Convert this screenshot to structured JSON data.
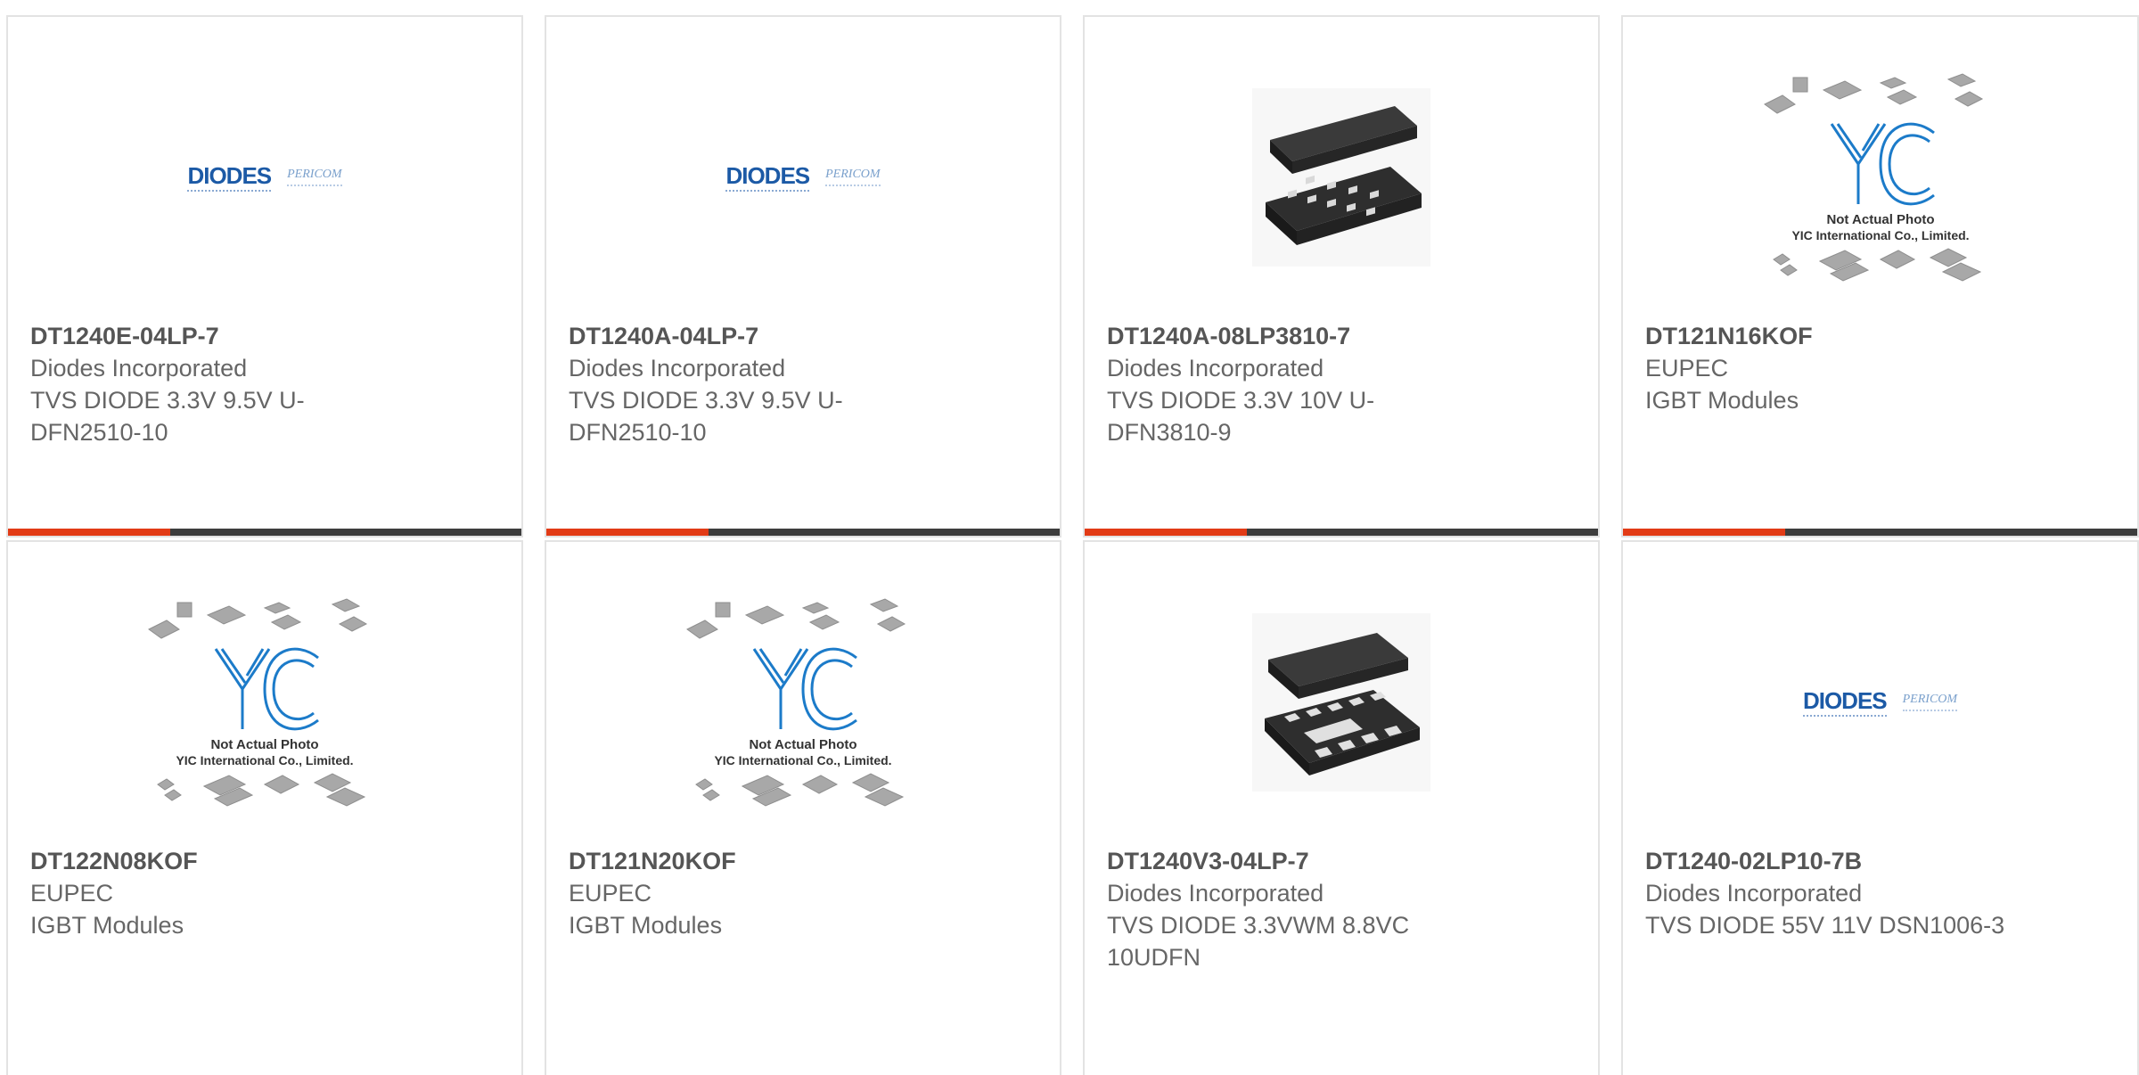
{
  "products": [
    {
      "part_number": "DT1240E-04LP-7",
      "manufacturer": "Diodes Incorporated",
      "description": "TVS DIODE 3.3V 9.5V U-DFN2510-10",
      "image": "diodes-pericom-logo"
    },
    {
      "part_number": "DT1240A-04LP-7",
      "manufacturer": "Diodes Incorporated",
      "description": "TVS DIODE 3.3V 9.5V U-DFN2510-10",
      "image": "diodes-pericom-logo"
    },
    {
      "part_number": "DT1240A-08LP3810-7",
      "manufacturer": "Diodes Incorporated",
      "description": "TVS DIODE 3.3V 10V U-DFN3810-9",
      "image": "dfn-package-photo-a"
    },
    {
      "part_number": "DT121N16KOF",
      "manufacturer": "EUPEC",
      "description": "IGBT Modules",
      "image": "yic-placeholder",
      "placeholder_line1": "Not Actual Photo",
      "placeholder_line2": "YIC International Co., Limited."
    },
    {
      "part_number": "DT122N08KOF",
      "manufacturer": "EUPEC",
      "description": "IGBT Modules",
      "image": "yic-placeholder",
      "placeholder_line1": "Not Actual Photo",
      "placeholder_line2": "YIC International Co., Limited."
    },
    {
      "part_number": "DT121N20KOF",
      "manufacturer": "EUPEC",
      "description": "IGBT Modules",
      "image": "yic-placeholder",
      "placeholder_line1": "Not Actual Photo",
      "placeholder_line2": "YIC International Co., Limited."
    },
    {
      "part_number": "DT1240V3-04LP-7",
      "manufacturer": "Diodes Incorporated",
      "description": "TVS DIODE 3.3VWM 8.8VC 10UDFN",
      "image": "dfn-package-photo-b"
    },
    {
      "part_number": "DT1240-02LP10-7B",
      "manufacturer": "Diodes Incorporated",
      "description": "TVS DIODE 55V 11V DSN1006-3",
      "image": "diodes-pericom-logo"
    }
  ],
  "logos": {
    "diodes_text": "DIODES",
    "pericom_text": "PERICOM",
    "yic_text": "YIC"
  },
  "colors": {
    "accent": "#e23b16",
    "bar": "#3d3d3d",
    "card_border": "#e3e3e3",
    "diodes_blue": "#1c5aa6"
  }
}
